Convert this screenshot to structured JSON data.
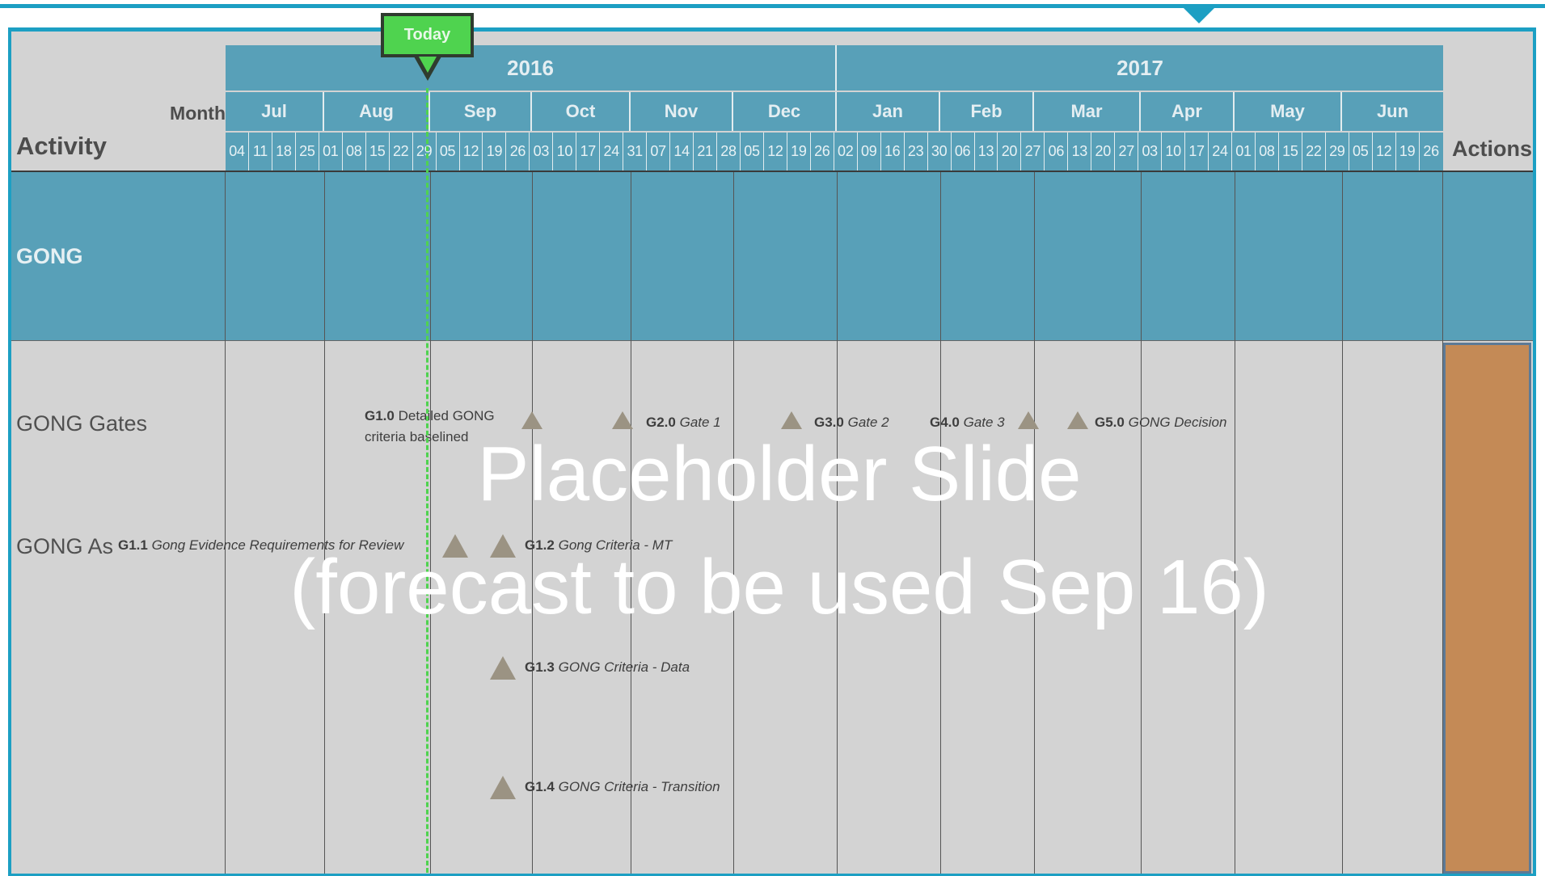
{
  "header": {
    "years": [
      "2016",
      "2017"
    ],
    "months": [
      "Jul",
      "Aug",
      "Sep",
      "Oct",
      "Nov",
      "Dec",
      "Jan",
      "Feb",
      "Mar",
      "Apr",
      "May",
      "Jun"
    ],
    "weeks": [
      "04",
      "11",
      "18",
      "25",
      "01",
      "08",
      "15",
      "22",
      "29",
      "05",
      "12",
      "19",
      "26",
      "03",
      "10",
      "17",
      "24",
      "31",
      "07",
      "14",
      "21",
      "28",
      "05",
      "12",
      "19",
      "26",
      "02",
      "09",
      "16",
      "23",
      "30",
      "06",
      "13",
      "20",
      "27",
      "06",
      "13",
      "20",
      "27",
      "03",
      "10",
      "17",
      "24",
      "01",
      "08",
      "15",
      "22",
      "29",
      "05",
      "12",
      "19",
      "26"
    ],
    "month_label": "Month",
    "activity_label": "Activity",
    "actions_label": "Actions",
    "today_label": "Today"
  },
  "rows": {
    "group": "GONG",
    "gates": "GONG Gates",
    "assessment": "GONG As"
  },
  "milestones": {
    "g1_0": {
      "id": "G1.0",
      "text_line1": "Detailed GONG",
      "text_line2": "criteria baselined"
    },
    "g2_0": {
      "id": "G2.0",
      "text": "Gate 1"
    },
    "g3_0": {
      "id": "G3.0",
      "text": "Gate 2"
    },
    "g4_0": {
      "id": "G4.0",
      "text": "Gate 3"
    },
    "g5_0": {
      "id": "G5.0",
      "text": "GONG Decision"
    },
    "g1_1": {
      "id": "G1.1",
      "text": "Gong Evidence Requirements for Review"
    },
    "g1_2": {
      "id": "G1.2",
      "text": "Gong Criteria - MT"
    },
    "g1_3": {
      "id": "G1.3",
      "text": "GONG Criteria - Data"
    },
    "g1_4": {
      "id": "G1.4",
      "text": "GONG Criteria - Transition"
    }
  },
  "overlay": {
    "line1": "Placeholder Slide",
    "line2": "(forecast to be used Sep 16)"
  },
  "colors": {
    "accent": "#1c9fc3",
    "header_fill": "#58a0b8",
    "today": "#4fd34f",
    "milestone": "#9b9383",
    "actions_fill": "#c48a56",
    "background": "#d3d3d3"
  }
}
